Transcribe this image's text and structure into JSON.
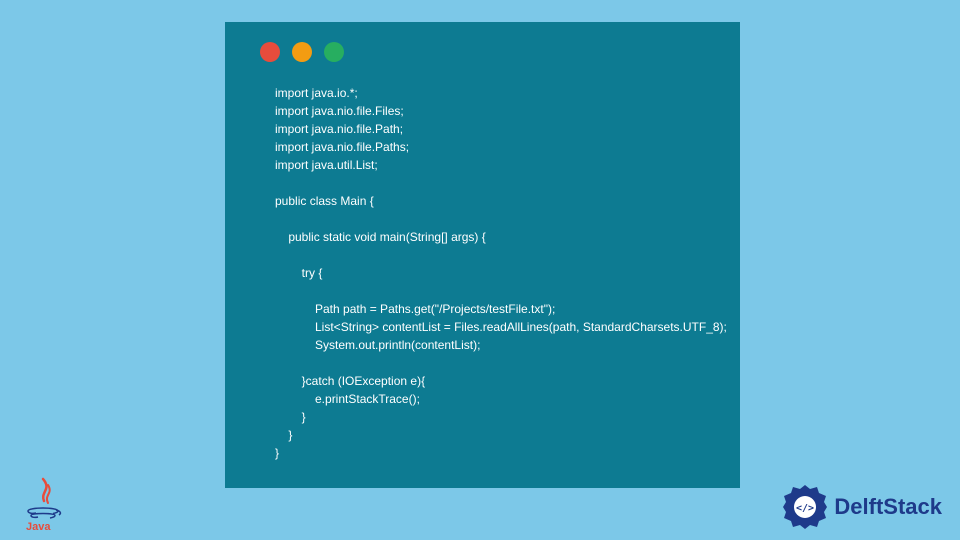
{
  "code": {
    "lines": [
      "import java.io.*;",
      "import java.nio.file.Files;",
      "import java.nio.file.Path;",
      "import java.nio.file.Paths;",
      "import java.util.List;",
      "",
      "public class Main {",
      "",
      "    public static void main(String[] args) {",
      "",
      "        try {",
      "",
      "            Path path = Paths.get(\"/Projects/testFile.txt\");",
      "            List<String> contentList = Files.readAllLines(path, StandardCharsets.UTF_8);",
      "            System.out.println(contentList);",
      "",
      "        }catch (IOException e){",
      "            e.printStackTrace();",
      "        }",
      "    }",
      "}"
    ]
  },
  "branding": {
    "java_label": "Java",
    "delft_label": "DelftStack"
  },
  "colors": {
    "background": "#7cc8e8",
    "window": "#0d7b92",
    "code_text": "#ffffff",
    "dot_red": "#e74c3c",
    "dot_yellow": "#f39c12",
    "dot_green": "#27ae60",
    "delft_blue": "#1e3a8a"
  }
}
